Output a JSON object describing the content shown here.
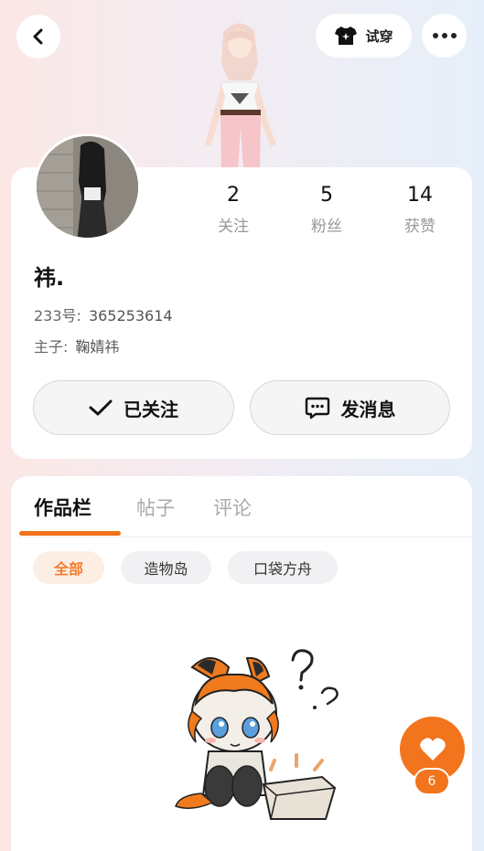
{
  "header": {
    "back_icon": "chevron-left-icon",
    "tryon_label": "试穿",
    "tryon_icon": "shirt-sparkle-icon",
    "more_icon": "more-dots-icon"
  },
  "profile": {
    "stats": [
      {
        "value": "2",
        "label": "关注"
      },
      {
        "value": "5",
        "label": "粉丝"
      },
      {
        "value": "14",
        "label": "获赞"
      }
    ],
    "username": "祎.",
    "uid_label": "233号:",
    "uid_value": "365253614",
    "owner_label": "主子:",
    "owner_value": "鞠婧祎",
    "followed_label": "已关注",
    "message_label": "发消息"
  },
  "tabs": [
    {
      "label": "作品栏",
      "active": true
    },
    {
      "label": "帖子",
      "active": false
    },
    {
      "label": "评论",
      "active": false
    }
  ],
  "filters": [
    {
      "label": "全部",
      "active": true
    },
    {
      "label": "造物岛",
      "active": false
    },
    {
      "label": "口袋方舟",
      "active": false
    }
  ],
  "like": {
    "count": "6",
    "icon": "heart-icon"
  },
  "colors": {
    "accent": "#f2741c",
    "chip_active_bg": "#fdeee4"
  }
}
